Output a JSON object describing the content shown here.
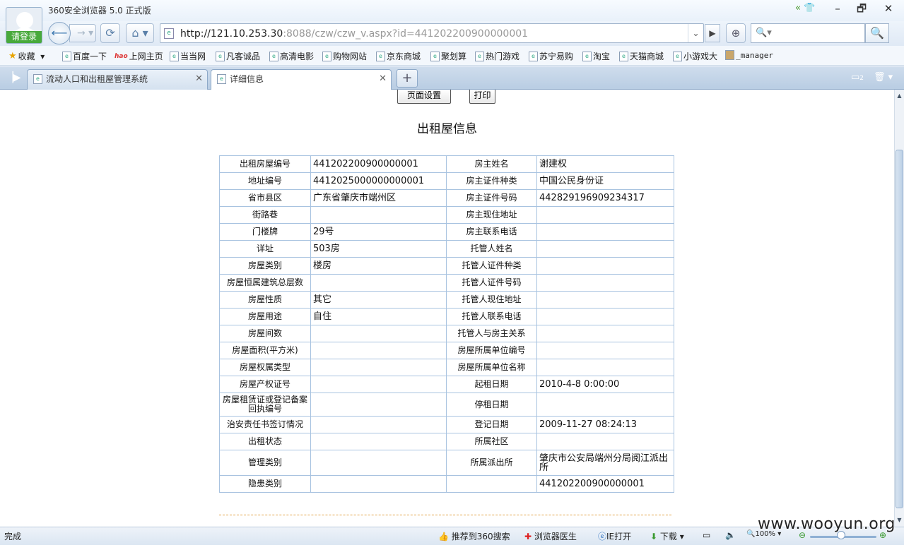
{
  "window": {
    "app_title": "360安全浏览器 5.0 正式版",
    "login_label": "请登录",
    "controls": {
      "skin": "«",
      "minimize": "–",
      "restore": "🗗",
      "close": "✕"
    }
  },
  "nav": {
    "url_host": "http://121.10.253.30",
    "url_rest": ":8088/czw/czw_v.aspx?id=441202200900000001",
    "search_placeholder": "▾"
  },
  "bookmarks": [
    {
      "label": "收藏",
      "icon": "star-icon"
    },
    {
      "label": "百度一下",
      "icon": "page-icon"
    },
    {
      "label": "上网主页",
      "icon": "hao-icon"
    },
    {
      "label": "当当网",
      "icon": "page-icon"
    },
    {
      "label": "凡客诚品",
      "icon": "page-icon"
    },
    {
      "label": "高清电影",
      "icon": "page-icon"
    },
    {
      "label": "购物网站",
      "icon": "page-icon"
    },
    {
      "label": "京东商城",
      "icon": "page-icon"
    },
    {
      "label": "聚划算",
      "icon": "page-icon"
    },
    {
      "label": "热门游戏",
      "icon": "page-icon"
    },
    {
      "label": "苏宁易购",
      "icon": "page-icon"
    },
    {
      "label": "淘宝",
      "icon": "page-icon"
    },
    {
      "label": "天猫商城",
      "icon": "page-icon"
    },
    {
      "label": "小游戏大",
      "icon": "page-icon"
    },
    {
      "label": "_manager",
      "icon": "image-icon"
    }
  ],
  "tabs": [
    {
      "label": "流动人口和出租屋管理系统",
      "active": false
    },
    {
      "label": "详细信息",
      "active": true
    }
  ],
  "tabbar_right": {
    "count": "2"
  },
  "page": {
    "page_setup_label": "页面设置",
    "print_label": "打印",
    "title": "出租屋信息",
    "rows": [
      {
        "l1": "出租房屋编号",
        "v1": "441202200900000001",
        "l2": "房主姓名",
        "v2": "谢建权"
      },
      {
        "l1": "地址编号",
        "v1": "4412025000000000001",
        "l2": "房主证件种类",
        "v2": "中国公民身份证"
      },
      {
        "l1": "省市县区",
        "v1": "广东省肇庆市端州区",
        "l2": "房主证件号码",
        "v2": "442829196909234317"
      },
      {
        "l1": "街路巷",
        "v1": "",
        "l2": "房主现住地址",
        "v2": ""
      },
      {
        "l1": "门楼牌",
        "v1": "29号",
        "l2": "房主联系电话",
        "v2": ""
      },
      {
        "l1": "详址",
        "v1": "503房",
        "l2": "托管人姓名",
        "v2": ""
      },
      {
        "l1": "房屋类别",
        "v1": "楼房",
        "l2": "托管人证件种类",
        "v2": ""
      },
      {
        "l1": "房屋恒属建筑总层数",
        "v1": "",
        "l2": "托管人证件号码",
        "v2": ""
      },
      {
        "l1": "房屋性质",
        "v1": "其它",
        "l2": "托管人现住地址",
        "v2": ""
      },
      {
        "l1": "房屋用途",
        "v1": "自住",
        "l2": "托管人联系电话",
        "v2": ""
      },
      {
        "l1": "房屋间数",
        "v1": "",
        "l2": "托管人与房主关系",
        "v2": ""
      },
      {
        "l1": "房屋面积(平方米)",
        "v1": "",
        "l2": "房屋所属单位编号",
        "v2": ""
      },
      {
        "l1": "房屋权属类型",
        "v1": "",
        "l2": "房屋所属单位名称",
        "v2": ""
      },
      {
        "l1": "房屋产权证号",
        "v1": "",
        "l2": "起租日期",
        "v2": "2010-4-8 0:00:00"
      },
      {
        "l1": "房屋租赁证或登记备案回执编号",
        "v1": "",
        "l2": "停租日期",
        "v2": ""
      },
      {
        "l1": "治安责任书签订情况",
        "v1": "",
        "l2": "登记日期",
        "v2": "2009-11-27 08:24:13"
      },
      {
        "l1": "出租状态",
        "v1": "",
        "l2": "所属社区",
        "v2": ""
      },
      {
        "l1": "管理类别",
        "v1": "",
        "l2": "所属派出所",
        "v2": "肇庆市公安局端州分局阅江派出所"
      },
      {
        "l1": "隐患类别",
        "v1": "",
        "l2": "",
        "v2": "441202200900000001"
      }
    ]
  },
  "status": {
    "left": "完成",
    "recommend": "推荐到360搜索",
    "doctor": "浏览器医生",
    "ie_open": "IE打开",
    "download": "下载",
    "zoom": "100%"
  },
  "watermark": "www.wooyun.org"
}
